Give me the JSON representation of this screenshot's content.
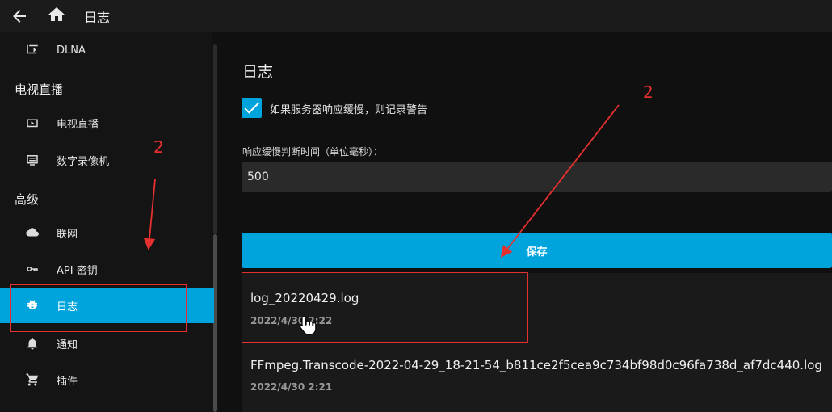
{
  "header": {
    "title": "日志"
  },
  "sidebar": {
    "items_top": [
      {
        "label": "DLNA",
        "icon": "dlna-icon"
      }
    ],
    "section_livetv": "电视直播",
    "items_livetv": [
      {
        "label": "电视直播",
        "icon": "tv-icon"
      },
      {
        "label": "数字录像机",
        "icon": "dvr-icon"
      }
    ],
    "section_advanced": "高级",
    "items_advanced": [
      {
        "label": "联网",
        "icon": "cloud-icon"
      },
      {
        "label": "API 密钥",
        "icon": "key-icon"
      },
      {
        "label": "日志",
        "icon": "bug-icon",
        "active": true
      },
      {
        "label": "通知",
        "icon": "bell-icon"
      },
      {
        "label": "插件",
        "icon": "cart-icon"
      }
    ]
  },
  "main": {
    "title": "日志",
    "checkbox_label": "如果服务器响应缓慢，则记录警告",
    "checkbox_checked": true,
    "slow_response_label": "响应缓慢判断时间（单位毫秒）：",
    "slow_response_value": "500",
    "save_label": "保存",
    "logs": [
      {
        "name": "log_20220429.log",
        "date": "2022/4/30 2:22"
      },
      {
        "name": "FFmpeg.Transcode-2022-04-29_18-21-54_b811ce2f5cea9c734bf98d0c96fa738d_af7dc440.log",
        "date": "2022/4/30 2:21"
      }
    ]
  },
  "annotations": {
    "left_number": "2",
    "right_number": "2"
  },
  "colors": {
    "accent": "#00a4dc",
    "annotation": "#e53030"
  }
}
